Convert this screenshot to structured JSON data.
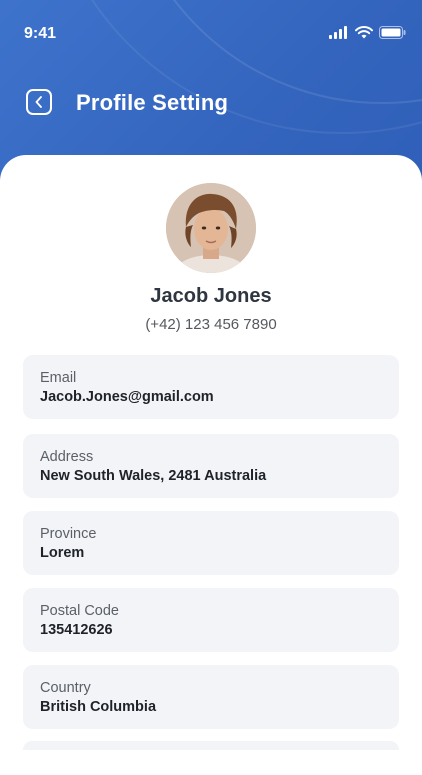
{
  "status_bar": {
    "time": "9:41"
  },
  "header": {
    "title": "Profile Setting"
  },
  "profile": {
    "name": "Jacob Jones",
    "phone": "(+42) 123 456 7890"
  },
  "fields": [
    {
      "label": "Email",
      "value": "Jacob.Jones@gmail.com"
    },
    {
      "label": "Address",
      "value": "New South Wales, 2481 Australia"
    },
    {
      "label": "Province",
      "value": "Lorem"
    },
    {
      "label": "Postal Code",
      "value": "135412626"
    },
    {
      "label": "Country",
      "value": "British Columbia"
    }
  ],
  "colors": {
    "header": "#3a6fc9",
    "card": "#f3f4f7"
  }
}
